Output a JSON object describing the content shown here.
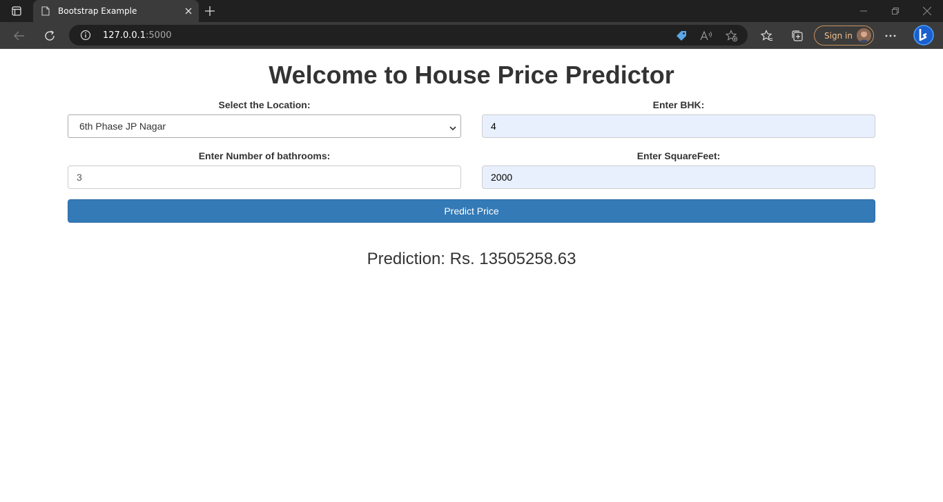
{
  "browser": {
    "tab_title": "Bootstrap Example",
    "url_host": "127.0.0.1",
    "url_port": ":5000",
    "sign_in_label": "Sign in"
  },
  "page": {
    "title": "Welcome to House Price Predictor",
    "location": {
      "label": "Select the Location:",
      "selected": "6th Phase JP Nagar"
    },
    "bhk": {
      "label": "Enter BHK:",
      "value": "4"
    },
    "bathrooms": {
      "label": "Enter Number of bathrooms:",
      "value": "3"
    },
    "sqft": {
      "label": "Enter SquareFeet:",
      "value": "2000"
    },
    "predict_button": "Predict Price",
    "prediction_text": "Prediction: Rs. 13505258.63"
  },
  "colors": {
    "primary_button": "#337ab7",
    "autofill_bg": "#e8f0fe",
    "chrome_dark": "#202020",
    "chrome_mid": "#3b3b3b"
  },
  "icons": [
    "tab-actions-icon",
    "page-icon",
    "close-icon",
    "plus-icon",
    "minimize-icon",
    "restore-icon",
    "window-close-icon",
    "back-icon",
    "refresh-icon",
    "info-icon",
    "coupon-icon",
    "read-aloud-icon",
    "add-favorite-icon",
    "favorites-icon",
    "collections-icon",
    "more-icon",
    "copilot-icon",
    "chevron-down-icon"
  ]
}
